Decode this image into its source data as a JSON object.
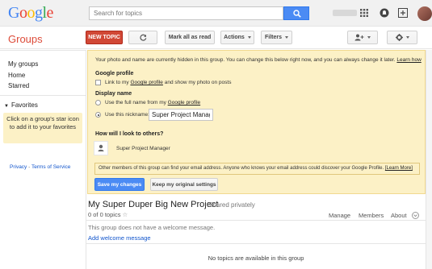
{
  "google_logo": {
    "letters": [
      "G",
      "o",
      "o",
      "g",
      "l",
      "e"
    ],
    "colors": [
      "#4285f4",
      "#ea4335",
      "#fbbc05",
      "#4285f4",
      "#34a853",
      "#ea4335"
    ]
  },
  "search": {
    "placeholder": "Search for topics"
  },
  "app": {
    "title": "Groups"
  },
  "toolbar": {
    "new_topic": "NEW TOPIC",
    "mark_all_read": "Mark all as read",
    "actions": "Actions",
    "filters": "Filters"
  },
  "sidebar": {
    "items": [
      {
        "label": "My groups"
      },
      {
        "label": "Home"
      },
      {
        "label": "Starred"
      }
    ],
    "favorites": {
      "header": "Favorites",
      "hint": "Click on a group's star icon to add it to your favorites"
    },
    "footer": {
      "privacy": "Privacy",
      "separator": " - ",
      "terms": "Terms of Service"
    }
  },
  "panel": {
    "intro": "Your photo and name are currently hidden in this group. You can change this below right now, and you can always change it later.",
    "learn_how": "Learn how",
    "profile_header": "Google profile",
    "link_profile_prefix": "Link to my ",
    "link_profile_link": "Google profile",
    "link_profile_suffix": " and show my photo on posts",
    "display_name_header": "Display name",
    "full_name_prefix": "Use the full name from my ",
    "full_name_link": "Google profile",
    "nickname_label": "Use this nickname:",
    "nickname_value": "Super Project Manager",
    "look_header": "How will I look to others?",
    "preview_name": "Super Project Manager",
    "email_notice": "Other members of this group can find your email address. Anyone who knows your email address could discover your Google Profile.",
    "learn_more": "[Learn More]",
    "save_button": "Save my changes",
    "keep_button": "Keep my original settings"
  },
  "group": {
    "title": "My Super Duper Big New Project",
    "sharing": "Shared privately",
    "topic_count": "0 of 0 topics",
    "menu": [
      "Manage",
      "Members",
      "About"
    ],
    "welcome_message": "This group does not have a welcome message.",
    "add_welcome": "Add welcome message",
    "no_topics": "No topics are available in this group"
  }
}
